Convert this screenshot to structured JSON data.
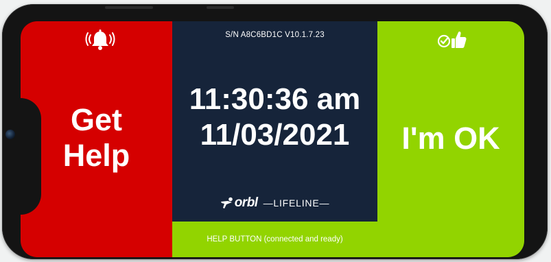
{
  "device": {
    "serial_version": "S/N A8C6BD1C V10.1.7.23"
  },
  "help_panel": {
    "label_line1": "Get",
    "label_line2": "Help",
    "icon": "alarm-bell-icon",
    "color": "#d50000"
  },
  "clock": {
    "time": "11:30:36 am",
    "date": "11/03/2021"
  },
  "brand": {
    "name": "orbl",
    "product": "—LIFELINE—",
    "logo": "orbl-logo-icon"
  },
  "status": {
    "text": "HELP BUTTON (connected and ready)",
    "color": "#92d400"
  },
  "ok_panel": {
    "label": "I'm OK",
    "icon": "check-thumbs-up-icon",
    "color": "#92d400"
  },
  "center_color": "#16243a"
}
